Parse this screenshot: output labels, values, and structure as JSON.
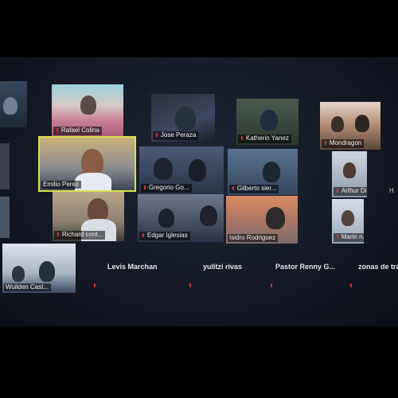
{
  "participants": [
    {
      "name": "Rafael Colina"
    },
    {
      "name": "Jose Peraza"
    },
    {
      "name": "Katherin Yanez"
    },
    {
      "name": "Mondragon"
    },
    {
      "name": "Emilio Perez"
    },
    {
      "name": "Gregorio Go..."
    },
    {
      "name": "Gilberto sier..."
    },
    {
      "name": "Arthur Diaz"
    },
    {
      "name": "Richard cont..."
    },
    {
      "name": "Edgar Iglesias"
    },
    {
      "name": "Isidro Rodriguez"
    },
    {
      "name": "Marin rueda"
    },
    {
      "name": "Wuilden Cast..."
    }
  ],
  "name_only": [
    {
      "name": "Levis Marchan"
    },
    {
      "name": "yulitzi rivas"
    },
    {
      "name": "Pastor Renny G..."
    },
    {
      "name": "zonas de tra..."
    }
  ],
  "side_partial": {
    "name": "H"
  },
  "colors": {
    "muted_mic": "#e53935",
    "active_speaker_border": "#d8e24a",
    "background": "#000000"
  },
  "icons": {
    "mic": "muted-mic-icon"
  }
}
